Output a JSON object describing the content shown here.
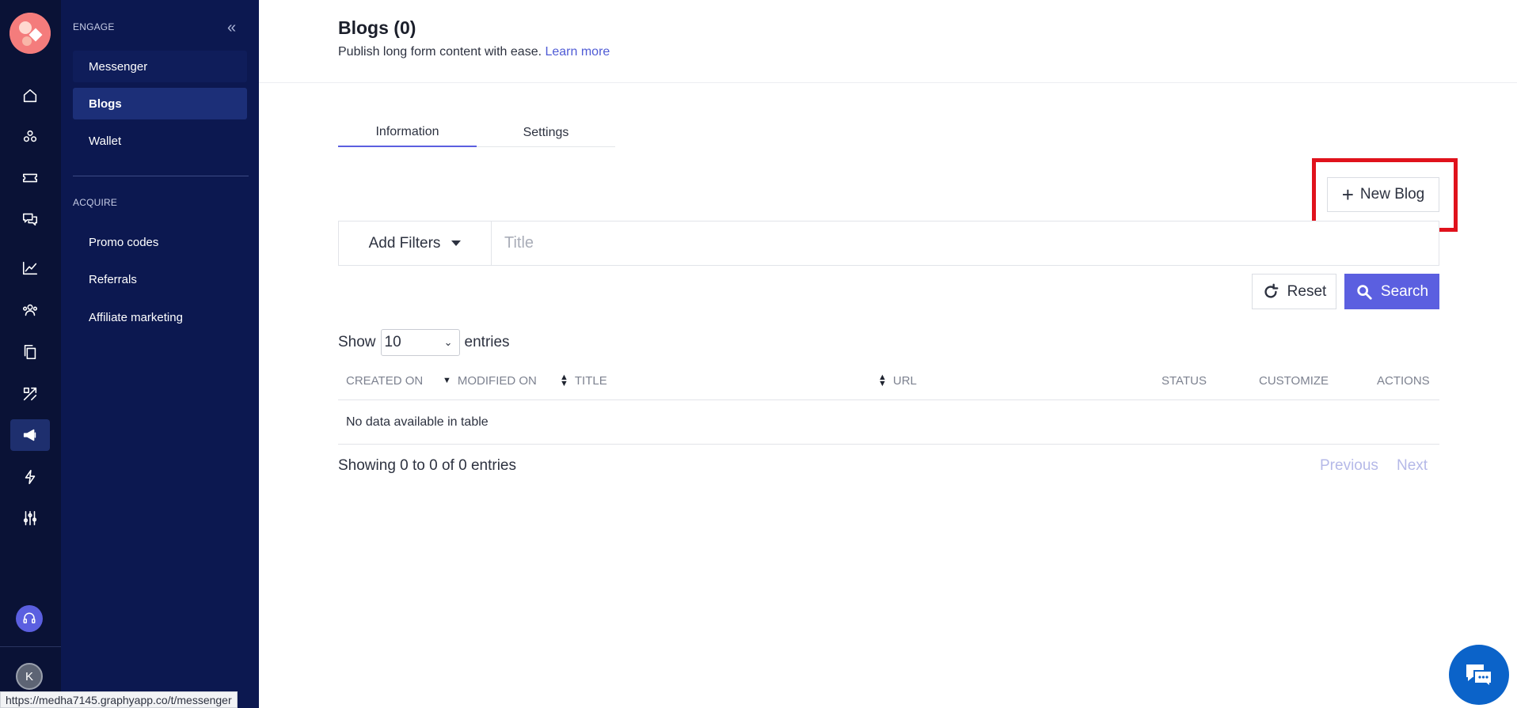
{
  "rail": {
    "icons": [
      "home-icon",
      "apps-icon",
      "ticket-icon",
      "chat-icon",
      "analytics-icon",
      "people-icon",
      "copy-icon",
      "design-icon",
      "megaphone-icon",
      "bolt-icon",
      "sliders-icon"
    ],
    "avatar_initial": "K"
  },
  "subnav": {
    "engage_label": "ENGAGE",
    "engage_items": [
      {
        "label": "Messenger"
      },
      {
        "label": "Blogs"
      },
      {
        "label": "Wallet"
      }
    ],
    "acquire_label": "ACQUIRE",
    "acquire_items": [
      {
        "label": "Promo codes"
      },
      {
        "label": "Referrals"
      },
      {
        "label": "Affiliate marketing"
      }
    ]
  },
  "header": {
    "title": "Blogs (0)",
    "subtitle": "Publish long form content with ease.",
    "learn_more": "Learn more"
  },
  "tabs": [
    {
      "label": "Information"
    },
    {
      "label": "Settings"
    }
  ],
  "actions": {
    "new_blog": "New Blog"
  },
  "filters": {
    "add_filters": "Add Filters",
    "title_placeholder": "Title",
    "reset": "Reset",
    "search": "Search"
  },
  "table": {
    "show_label": "Show",
    "entries_label": "entries",
    "page_size": "10",
    "columns": [
      "CREATED ON",
      "MODIFIED ON",
      "TITLE",
      "URL",
      "STATUS",
      "CUSTOMIZE",
      "ACTIONS"
    ],
    "empty_message": "No data available in table",
    "info": "Showing 0 to 0 of 0 entries",
    "previous": "Previous",
    "next": "Next"
  },
  "status_url": "https://medha7145.graphyapp.co/t/messenger",
  "colors": {
    "rail_bg": "#0a1236",
    "subnav_bg": "#0c1850",
    "accent": "#5b5fe0",
    "highlight": "#e0121c",
    "chat": "#0b63c9"
  }
}
